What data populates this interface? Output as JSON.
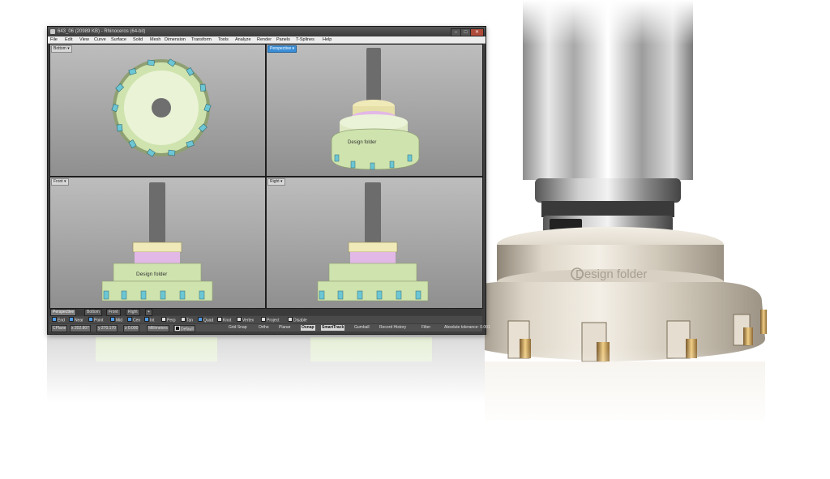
{
  "window": {
    "title": "643_06 (20989 KB) - Rhinoceros (64-bit)",
    "controls": {
      "minimize": "–",
      "maximize": "□",
      "close": "✕"
    }
  },
  "menu": {
    "items": [
      "File",
      "Edit",
      "View",
      "Curve",
      "Surface",
      "Solid",
      "Mesh",
      "Dimension",
      "Transform",
      "Tools",
      "Analyze",
      "Render",
      "Panels",
      "T-Splines",
      "Help"
    ]
  },
  "viewports": {
    "bottom": {
      "label": "Bottom ▾"
    },
    "perspective": {
      "label": "Perspective ▾"
    },
    "front": {
      "label": "Front ▾"
    },
    "right": {
      "label": "Right ▾"
    }
  },
  "tool_engraving": "Design folder",
  "viewport_tabs": [
    "Perspective",
    "Bottom",
    "Front",
    "Right",
    "+"
  ],
  "osnaps": [
    {
      "label": "End",
      "checked": true
    },
    {
      "label": "Near",
      "checked": true
    },
    {
      "label": "Point",
      "checked": true
    },
    {
      "label": "Mid",
      "checked": true
    },
    {
      "label": "Cen",
      "checked": true
    },
    {
      "label": "Int",
      "checked": true
    },
    {
      "label": "Perp",
      "checked": false
    },
    {
      "label": "Tan",
      "checked": false
    },
    {
      "label": "Quad",
      "checked": true
    },
    {
      "label": "Knot",
      "checked": false
    },
    {
      "label": "Vertex",
      "checked": false
    },
    {
      "label": "Project",
      "checked": false
    },
    {
      "label": "Disable",
      "checked": false
    }
  ],
  "status": {
    "cplane": "CPlane",
    "x": "x 202.807",
    "y": "y 270.170",
    "z": "z 0.000",
    "units": "Millimeters",
    "layer": "Default",
    "toggles": [
      "Grid Snap",
      "Ortho",
      "Planar",
      "Osnap",
      "SmartTrack",
      "Gumball",
      "Record History",
      "Filter"
    ],
    "toggles_on": [
      "Osnap",
      "SmartTrack"
    ],
    "tolerance": "Absolute tolerance: 0.001"
  },
  "colors": {
    "window_bg": "#3d3d3d",
    "viewport_top": "#bdbdbd",
    "viewport_bottom": "#8f8f8f",
    "active_label": "#3b8fd8",
    "tool_body": "#cfe3ae",
    "tool_highlight": "#f0e9b8",
    "inserts": "#6cc6d4",
    "spacer": "#e2b8e6"
  }
}
